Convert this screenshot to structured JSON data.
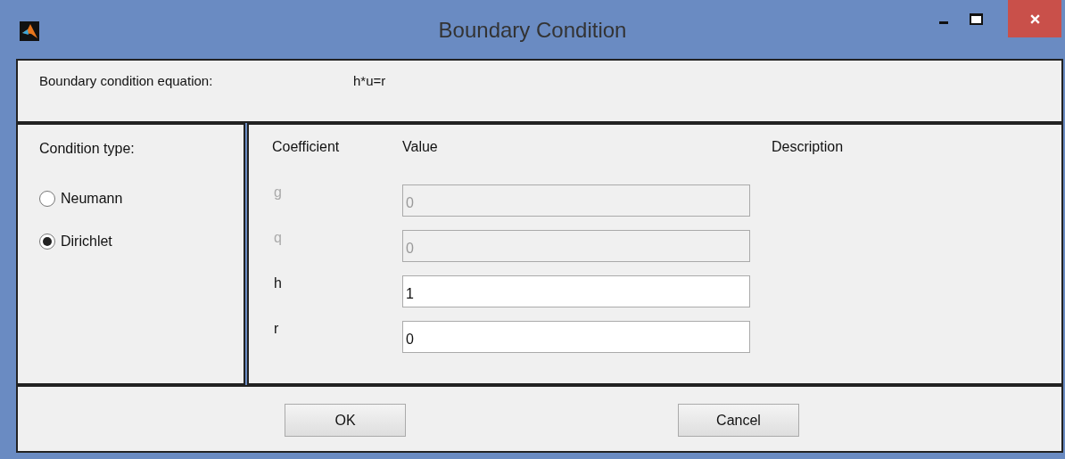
{
  "window": {
    "title": "Boundary Condition"
  },
  "equation": {
    "label": "Boundary condition equation:",
    "value": "h*u=r"
  },
  "condition_type": {
    "label": "Condition type:",
    "options": [
      {
        "label": "Neumann",
        "selected": false
      },
      {
        "label": "Dirichlet",
        "selected": true
      }
    ]
  },
  "coefficients": {
    "columns": [
      "Coefficient",
      "Value",
      "Description"
    ],
    "rows": [
      {
        "name": "g",
        "value": "0",
        "disabled": true
      },
      {
        "name": "q",
        "value": "0",
        "disabled": true
      },
      {
        "name": "h",
        "value": "1",
        "disabled": false
      },
      {
        "name": "r",
        "value": "0",
        "disabled": false
      }
    ]
  },
  "buttons": [
    "OK",
    "Cancel"
  ]
}
